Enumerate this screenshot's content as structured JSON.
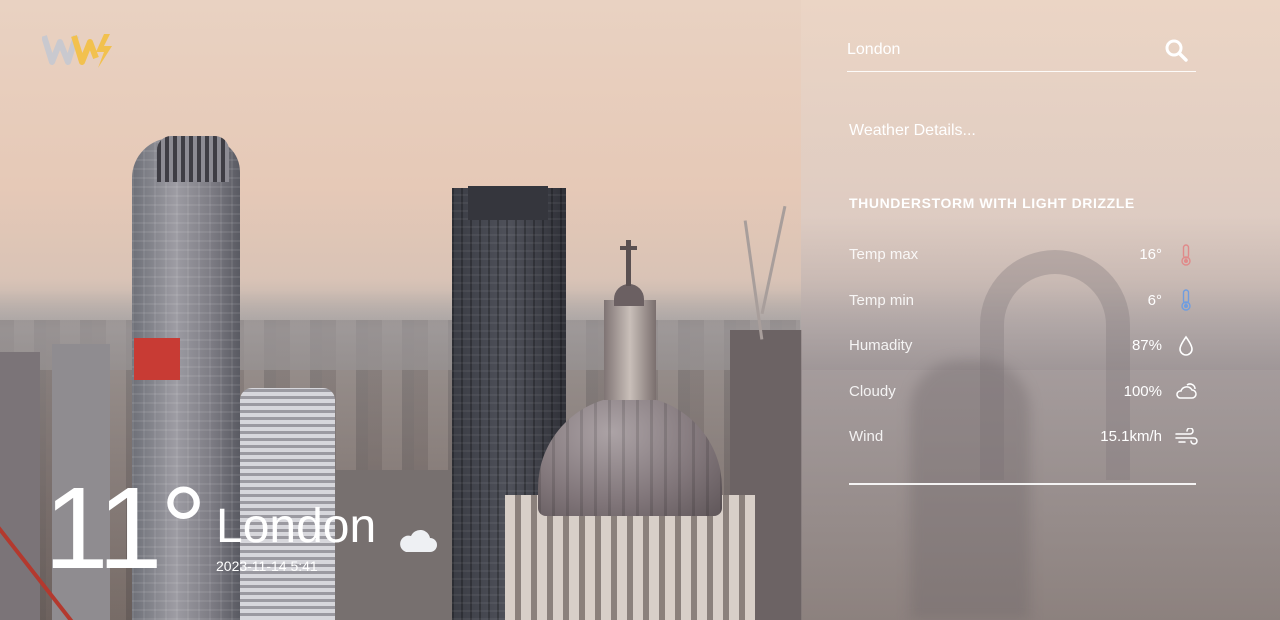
{
  "brand": {
    "logo_icon": "ww-lightning-logo-icon"
  },
  "search": {
    "value": "London",
    "icon": "search-icon"
  },
  "panel": {
    "details_title": "Weather Details...",
    "condition": "THUNDERSTORM WITH LIGHT DRIZZLE",
    "rows": [
      {
        "label": "Temp max",
        "value": "16°",
        "icon": "thermometer-hot-icon",
        "icon_color": "#e08a8a"
      },
      {
        "label": "Temp min",
        "value": "6°",
        "icon": "thermometer-cold-icon",
        "icon_color": "#6f9de0"
      },
      {
        "label": "Humadity",
        "value": "87%",
        "icon": "water-drop-icon",
        "icon_color": "#ffffff"
      },
      {
        "label": "Cloudy",
        "value": "100%",
        "icon": "cloud-sun-icon",
        "icon_color": "#ffffff"
      },
      {
        "label": "Wind",
        "value": "15.1km/h",
        "icon": "wind-icon",
        "icon_color": "#ffffff"
      }
    ]
  },
  "current": {
    "temperature": "11°",
    "city": "London",
    "datetime": "2023-11-14 5:41",
    "weather_icon": "cloud-icon"
  },
  "colors": {
    "logo_gray": "#c9c9cf",
    "logo_yellow": "#f2c14e",
    "text": "#ffffff"
  }
}
